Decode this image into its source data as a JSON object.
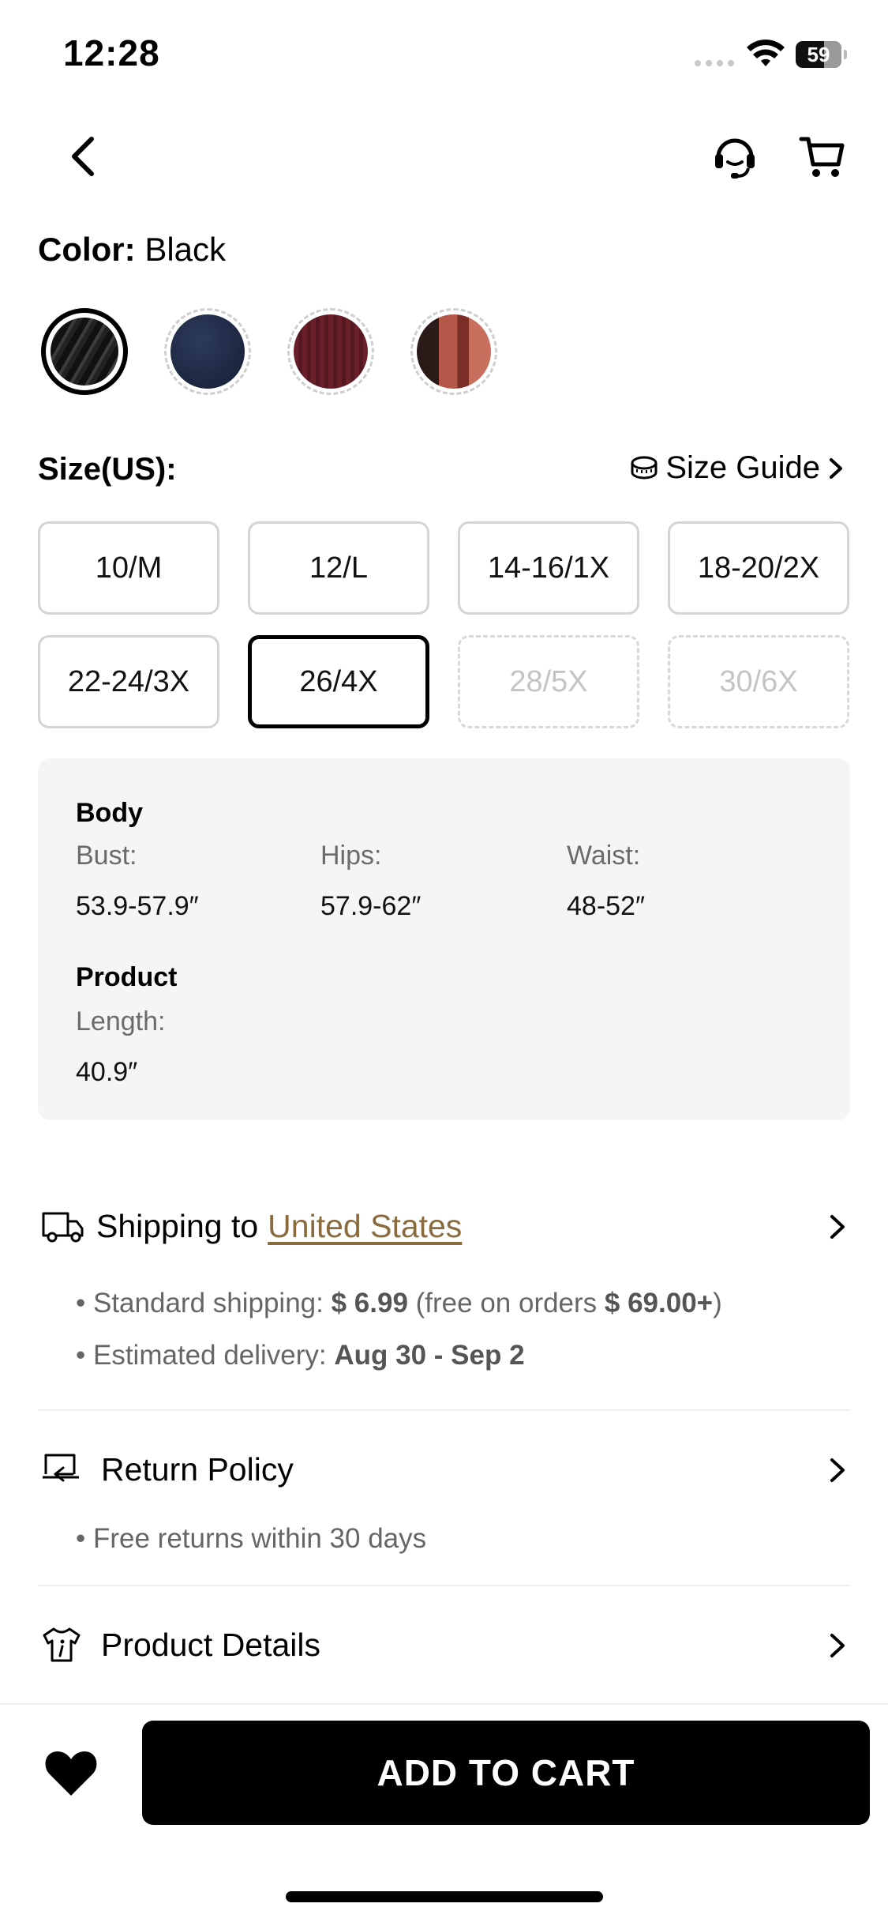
{
  "status_bar": {
    "time": "12:28",
    "battery": "59"
  },
  "color": {
    "label": "Color:",
    "value": "Black",
    "swatches": [
      {
        "name": "Black",
        "color": "#2a2a2a",
        "selected": true
      },
      {
        "name": "Navy",
        "color": "#1e2a44",
        "selected": false
      },
      {
        "name": "Burgundy",
        "color": "#5e1d26",
        "selected": false
      },
      {
        "name": "Pattern",
        "color": "#9a4a3c",
        "selected": false
      }
    ]
  },
  "size": {
    "label": "Size(US):",
    "guide_label": "Size Guide",
    "options": [
      {
        "label": "10/M",
        "state": "normal"
      },
      {
        "label": "12/L",
        "state": "normal"
      },
      {
        "label": "14-16/1X",
        "state": "normal"
      },
      {
        "label": "18-20/2X",
        "state": "normal"
      },
      {
        "label": "22-24/3X",
        "state": "normal"
      },
      {
        "label": "26/4X",
        "state": "selected"
      },
      {
        "label": "28/5X",
        "state": "disabled"
      },
      {
        "label": "30/6X",
        "state": "disabled"
      }
    ]
  },
  "measurements": {
    "body_title": "Body",
    "bust_label": "Bust:",
    "bust_value": "53.9-57.9″",
    "hips_label": "Hips:",
    "hips_value": "57.9-62″",
    "waist_label": "Waist:",
    "waist_value": "48-52″",
    "product_title": "Product",
    "length_label": "Length:",
    "length_value": "40.9″"
  },
  "shipping": {
    "title": "Shipping to",
    "country": "United States",
    "standard_label": "Standard shipping: ",
    "standard_price": "$ 6.99",
    "free_pre": " (free on orders ",
    "free_threshold": "$ 69.00+",
    "free_post": ")",
    "delivery_label": "Estimated delivery: ",
    "delivery_dates": "Aug 30 - Sep 2"
  },
  "returns": {
    "title": "Return Policy",
    "detail": "Free returns within 30 days"
  },
  "details": {
    "title": "Product Details"
  },
  "cart": {
    "button": "ADD TO CART"
  },
  "accent": "#8a6b3e"
}
